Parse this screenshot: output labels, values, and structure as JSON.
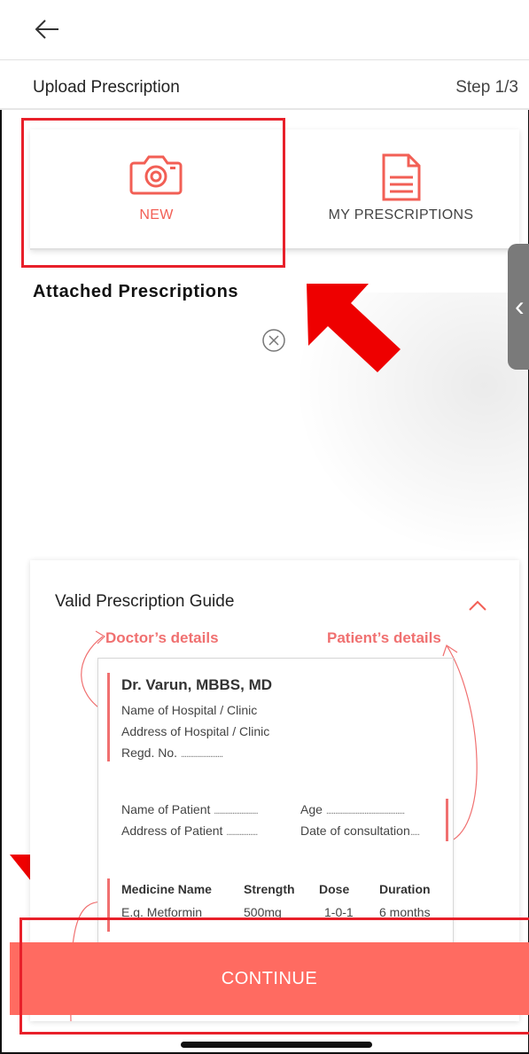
{
  "header": {
    "title": "Upload Prescription",
    "step": "Step 1/3"
  },
  "tabs": [
    {
      "label": "NEW",
      "icon": "camera-icon"
    },
    {
      "label": "MY PRESCRIPTIONS",
      "icon": "document-icon"
    }
  ],
  "attached": {
    "title": "Attached Prescriptions"
  },
  "guide": {
    "title": "Valid Prescription Guide",
    "doctor_label": "Doctor’s details",
    "patient_label": "Patient’s details",
    "sample": {
      "doctor_name": "Dr. Varun, MBBS, MD",
      "hospital_name": "Name of Hospital / Clinic",
      "hospital_address": "Address of Hospital / Clinic",
      "regd": "Regd. No.",
      "patient_name": "Name of Patient",
      "patient_address": "Address of Patient",
      "age": "Age",
      "date": "Date of consultation",
      "table": {
        "headers": [
          "Medicine Name",
          "Strength",
          "Dose",
          "Duration"
        ],
        "row": [
          "E.g. Metformin",
          "500mg",
          "1-0-1",
          "6 months"
        ]
      }
    }
  },
  "footer": {
    "continue_label": "CONTINUE"
  },
  "colors": {
    "accent": "#ff6b61",
    "annotation_red": "#e8202a",
    "guide_label": "#f07070"
  }
}
